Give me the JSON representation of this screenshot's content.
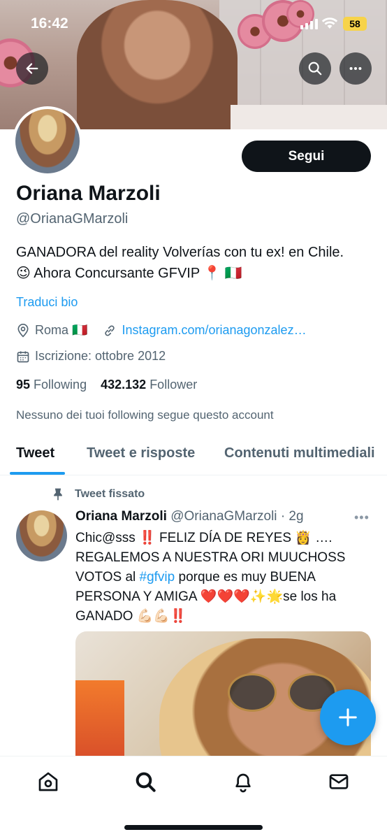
{
  "status_bar": {
    "time": "16:42",
    "battery": "58"
  },
  "profile": {
    "follow_label": "Segui",
    "name": "Oriana Marzoli",
    "handle": "@OrianaGMarzoli",
    "bio_line1": "GANADORA del reality Volverías con tu ex! en Chile.",
    "bio_line2": "😉 Ahora Concursante GFVIP 📍 🇮🇹",
    "translate_label": "Traduci bio",
    "location": "Roma 🇮🇹",
    "website": "Instagram.com/orianagonzalez…",
    "joined": "Iscrizione: ottobre 2012",
    "following_count": "95",
    "following_label": "Following",
    "followers_count": "432.132",
    "followers_label": "Follower",
    "mutuals_note": "Nessuno dei tuoi following segue questo account"
  },
  "tabs": [
    {
      "label": "Tweet"
    },
    {
      "label": "Tweet e risposte"
    },
    {
      "label": "Contenuti multimediali"
    }
  ],
  "tweet": {
    "pinned_label": "Tweet fissato",
    "author_name": "Oriana Marzoli",
    "author_handle": "@OrianaGMarzoli",
    "time_ago": "· 2g",
    "more_label": "•••",
    "text_part1": "Chic@sss ‼️ FELIZ DÍA DE REYES 👸 …. REGALEMOS A NUESTRA ORI MUUCHOSS VOTOS al ",
    "hashtag": "#gfvip",
    "text_part2": " porque es muy BUENA PERSONA Y AMIGA ❤️❤️❤️✨🌟se los ha GANADO 💪🏻💪🏻‼️"
  },
  "icons": {
    "back": "back-arrow-icon",
    "search": "search-icon",
    "more": "more-icon",
    "location": "location-pin-icon",
    "link": "link-icon",
    "calendar": "calendar-icon",
    "pin": "pin-icon",
    "compose": "plus-icon",
    "nav": [
      "home-icon",
      "search-icon",
      "notifications-icon",
      "messages-icon"
    ]
  },
  "colors": {
    "accent": "#1d9bf0",
    "text": "#0f1419",
    "secondary": "#536471"
  }
}
